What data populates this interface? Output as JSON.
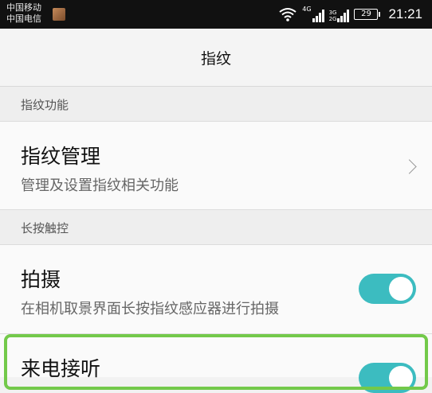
{
  "status_bar": {
    "carrier_1": "中国移动",
    "carrier_2": "中国电信",
    "network_1": "4G",
    "network_2a": "3G",
    "network_2b": "2G",
    "battery": "29",
    "time": "21:21"
  },
  "header": {
    "title": "指纹"
  },
  "sections": [
    {
      "header": "指纹功能",
      "items": [
        {
          "title": "指纹管理",
          "subtitle": "管理及设置指纹相关功能",
          "control": "chevron"
        }
      ]
    },
    {
      "header": "长按触控",
      "items": [
        {
          "title": "拍摄",
          "subtitle": "在相机取景界面长按指纹感应器进行拍摄",
          "control": "toggle",
          "on": true
        },
        {
          "title": "来电接听",
          "control": "toggle",
          "on": true
        }
      ]
    }
  ],
  "colors": {
    "toggle_on": "#3cbcc0",
    "highlight": "#73c94a"
  }
}
